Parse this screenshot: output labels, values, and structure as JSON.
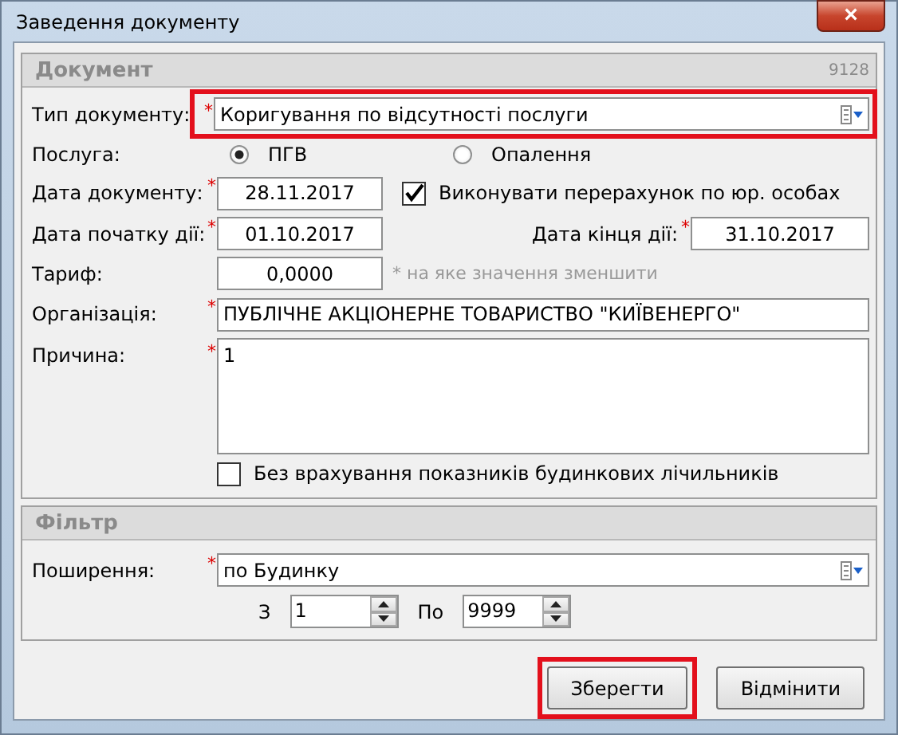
{
  "window": {
    "title": "Заведення документу",
    "close": "×"
  },
  "document": {
    "title": "Документ",
    "number": "9128",
    "doc_type": {
      "label": "Тип документу:",
      "required_mark": "*",
      "value": "Коригування по відсутності послуги",
      "highlighted": true
    },
    "service": {
      "label": "Послуга:",
      "options": [
        {
          "label": "ПГВ",
          "selected": true
        },
        {
          "label": "Опалення",
          "selected": false
        }
      ]
    },
    "doc_date": {
      "label": "Дата документу:",
      "required_mark": "*",
      "value": "28.11.2017"
    },
    "recalc": {
      "label": "Виконувати перерахунок по юр. особах",
      "checked": true
    },
    "start_date": {
      "label": "Дата початку дії:",
      "required_mark": "*",
      "value": "01.10.2017"
    },
    "end_date": {
      "label": "Дата кінця дії:",
      "required_mark": "*",
      "value": "31.10.2017"
    },
    "tariff": {
      "label": "Тариф:",
      "value": "0,0000",
      "hint": "* на яке значення зменшити"
    },
    "organization": {
      "label": "Організація:",
      "required_mark": "*",
      "value": "ПУБЛІЧНЕ АКЦІОНЕРНЕ ТОВАРИСТВО \"КИЇВЕНЕРГО\""
    },
    "reason": {
      "label": "Причина:",
      "required_mark": "*",
      "value": "1"
    },
    "ignore_meters": {
      "label": "Без врахування показників будинкових лічильників",
      "checked": false
    }
  },
  "filter": {
    "title": "Фільтр",
    "scope": {
      "label": "Поширення:",
      "required_mark": "*",
      "value": "по Будинку"
    },
    "from": {
      "label": "З",
      "value": "1"
    },
    "to": {
      "label": "По",
      "value": "9999"
    }
  },
  "buttons": [
    {
      "label": "Зберегти",
      "highlighted": true
    },
    {
      "label": "Відмінити",
      "highlighted": false
    }
  ]
}
